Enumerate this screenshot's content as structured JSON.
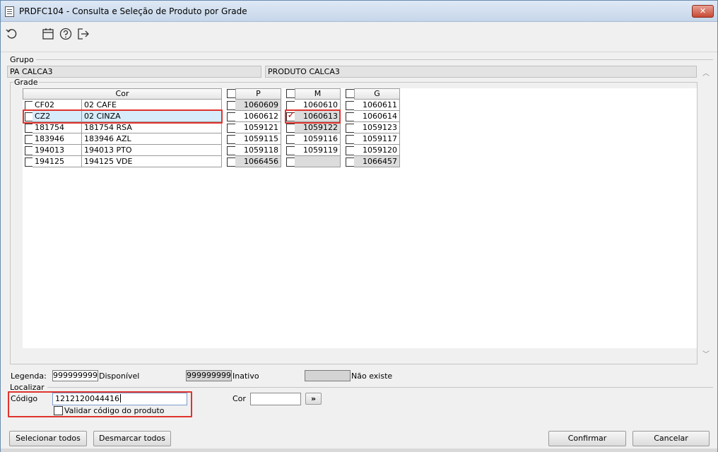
{
  "window": {
    "title": "PRDFC104 - Consulta e Seleção de Produto por Grade",
    "close_label": "✕"
  },
  "toolbar": {
    "icons": [
      "refresh-icon",
      "calendar-icon",
      "help-icon",
      "exit-icon"
    ]
  },
  "grupo": {
    "label": "Grupo",
    "code": "PA CALCA3",
    "description": "PRODUTO CALCA3"
  },
  "grade": {
    "label": "Grade",
    "color_header": "Cor",
    "size_headers": [
      "P",
      "M",
      "G"
    ],
    "rows": [
      {
        "code": "CF02",
        "name": "02 CAFE",
        "values": [
          "1060609",
          "1060610",
          "1060611"
        ],
        "status": [
          "inativo",
          "disponivel",
          "disponivel"
        ],
        "checked": [
          false,
          false,
          false
        ]
      },
      {
        "code": "CZ2",
        "name": "02 CINZA",
        "values": [
          "1060612",
          "1060613",
          "1060614"
        ],
        "status": [
          "disponivel",
          "inativo",
          "disponivel"
        ],
        "checked": [
          false,
          true,
          false
        ]
      },
      {
        "code": "181754",
        "name": "181754 RSA",
        "values": [
          "1059121",
          "1059122",
          "1059123"
        ],
        "status": [
          "disponivel",
          "inativo",
          "disponivel"
        ],
        "checked": [
          false,
          false,
          false
        ]
      },
      {
        "code": "183946",
        "name": "183946 AZL",
        "values": [
          "1059115",
          "1059116",
          "1059117"
        ],
        "status": [
          "disponivel",
          "disponivel",
          "disponivel"
        ],
        "checked": [
          false,
          false,
          false
        ]
      },
      {
        "code": "194013",
        "name": "194013 PTO",
        "values": [
          "1059118",
          "1059119",
          "1059120"
        ],
        "status": [
          "disponivel",
          "disponivel",
          "disponivel"
        ],
        "checked": [
          false,
          false,
          false
        ]
      },
      {
        "code": "194125",
        "name": "194125 VDE",
        "values": [
          "1066456",
          "",
          "1066457"
        ],
        "status": [
          "inativo",
          "nao-existe",
          "inativo"
        ],
        "checked": [
          false,
          false,
          false
        ]
      }
    ]
  },
  "legenda": {
    "label": "Legenda:",
    "disponivel_sample": "999999999",
    "disponivel_label": "Disponível",
    "inativo_sample": "999999999",
    "inativo_label": "Inativo",
    "nao_existe_label": "Não existe"
  },
  "localizar": {
    "label": "Localizar",
    "codigo_label": "Código",
    "codigo_value": "1212120044416",
    "validar_label": "Validar código do produto",
    "cor_label": "Cor",
    "cor_value": "",
    "go_label": "»"
  },
  "buttons": {
    "select_all": "Selecionar todos",
    "deselect_all": "Desmarcar todos",
    "confirm": "Confirmar",
    "cancel": "Cancelar"
  }
}
